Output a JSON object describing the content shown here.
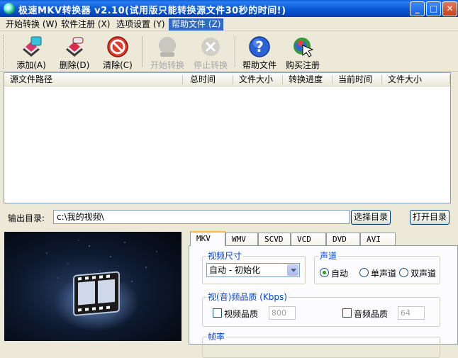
{
  "window": {
    "title": "极速MKV转换器 v2.10(试用版只能转换源文件30秒的时间!)",
    "minimize": "_",
    "maximize": "□",
    "close": "✕"
  },
  "menu": [
    {
      "label": "开始转换 (W)"
    },
    {
      "label": "软件注册 (X)"
    },
    {
      "label": "选项设置 (Y)"
    },
    {
      "label": "帮助文件 (Z)"
    }
  ],
  "toolbar": {
    "add": "添加(A)",
    "delete": "删除(D)",
    "clear": "清除(C)",
    "start": "开始转换",
    "stop": "停止转换",
    "help": "帮助文件",
    "buy": "购买注册"
  },
  "filelist": {
    "columns": [
      "源文件路径",
      "总时间",
      "文件大小",
      "转换进度",
      "当前时间",
      "文件大小"
    ]
  },
  "output": {
    "label": "输出目录:",
    "path": "c:\\我的视频\\",
    "choose": "选择目录",
    "open": "打开目录"
  },
  "tabs": [
    "MKV",
    "WMV",
    "SCVD",
    "VCD",
    "DVD",
    "AVI"
  ],
  "settings": {
    "video_size_title": "视频尺寸",
    "video_size_value": "自动 - 初始化",
    "channel_title": "声道",
    "channel_auto": "自动",
    "channel_mono": "单声道",
    "channel_stereo": "双声道",
    "quality_title": "视(音)频品质 (Kbps)",
    "video_quality": "视频品质",
    "video_quality_value": "800",
    "audio_quality": "音频品质",
    "audio_quality_value": "64",
    "framerate_title": "帧率"
  },
  "colors": {
    "titlebar": "#0a5fd8",
    "menu_active": "#316ac5",
    "group_title": "#0046d5"
  }
}
